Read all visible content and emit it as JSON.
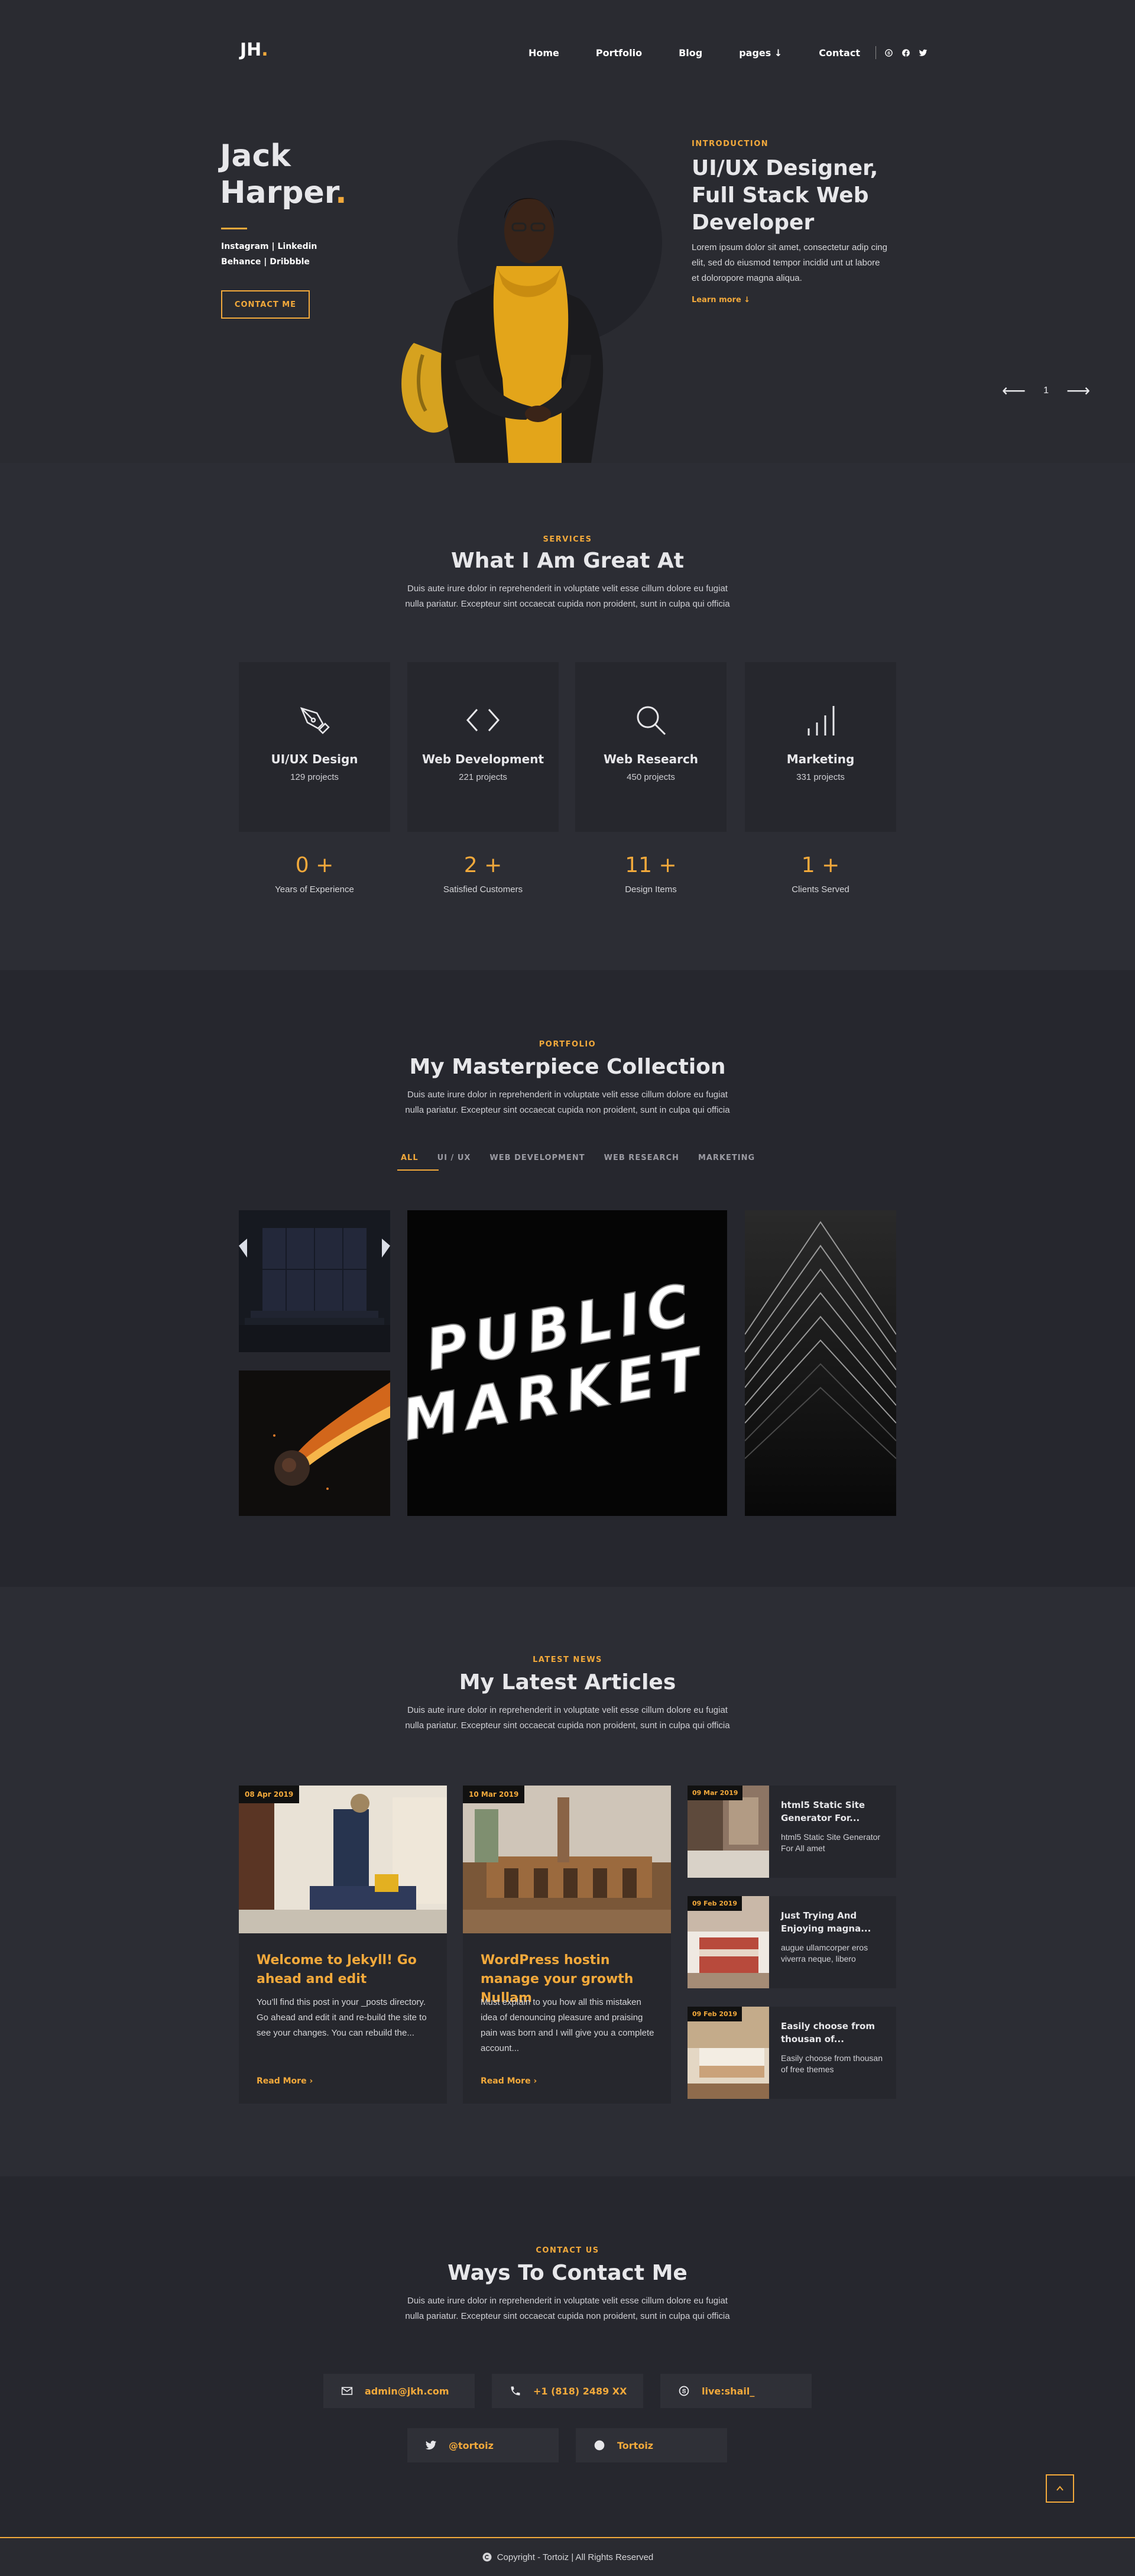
{
  "header": {
    "logo_text": "JH",
    "logo_dot": ".",
    "nav": [
      "Home",
      "Portfolio",
      "Blog",
      "pages",
      "Contact"
    ],
    "pages_caret": "↓",
    "social_icons": [
      "skype-icon",
      "facebook-icon",
      "twitter-icon"
    ]
  },
  "hero": {
    "first_name": "Jack",
    "last_name": "Harper",
    "dot": ".",
    "links_line1": "Instagram | Linkedin",
    "links_line2": "Behance | Dribbble",
    "contact_button": "CONTACT ME",
    "intro_kicker": "INTRODUCTION",
    "intro_title": "UI/UX Designer, Full Stack Web Developer",
    "intro_text": "Lorem ipsum dolor sit amet, consectetur adip cing elit, sed do eiusmod tempor incidid unt ut labore et doloropore magna aliqua.",
    "learn_more": "Learn more ↓",
    "slide_number": "1",
    "prev_arrow": "⟵",
    "next_arrow": "⟶"
  },
  "services": {
    "kicker": "SERVICES",
    "title": "What I Am Great At",
    "desc": "Duis aute irure dolor in reprehenderit in voluptate velit esse cillum dolore eu fugiat nulla pariatur. Excepteur sint occaecat cupida non proident, sunt in culpa qui officia",
    "cards": [
      {
        "name": "UI/UX Design",
        "count": "129 projects",
        "icon": "pen-tool-icon"
      },
      {
        "name": "Web Development",
        "count": "221 projects",
        "icon": "code-icon"
      },
      {
        "name": "Web Research",
        "count": "450 projects",
        "icon": "magnifier-icon"
      },
      {
        "name": "Marketing",
        "count": "331 projects",
        "icon": "bar-chart-icon"
      }
    ],
    "stats": [
      {
        "value": "0 +",
        "label": "Years of Experience"
      },
      {
        "value": "2 +",
        "label": "Satisfied Customers"
      },
      {
        "value": "11 +",
        "label": "Design Items"
      },
      {
        "value": "1 +",
        "label": "Clients Served"
      }
    ]
  },
  "portfolio": {
    "kicker": "PORTFOLIO",
    "title": "My Masterpiece Collection",
    "desc": "Duis aute irure dolor in reprehenderit in voluptate velit esse cillum dolore eu fugiat nulla pariatur. Excepteur sint occaecat cupida non proident, sunt in culpa qui officia",
    "filters": [
      "ALL",
      "UI / UX",
      "WEB DEVELOPMENT",
      "WEB RESEARCH",
      "MARKETING"
    ],
    "sign_line1": "PUBLIC",
    "sign_line2": "MARKET"
  },
  "news": {
    "kicker": "LATEST NEWS",
    "title": "My Latest Articles",
    "desc": "Duis aute irure dolor in reprehenderit in voluptate velit esse cillum dolore eu fugiat nulla pariatur. Excepteur sint occaecat cupida non proident, sunt in culpa qui officia",
    "posts": [
      {
        "date": "08 Apr 2019",
        "title": "Welcome to Jekyll! Go ahead and edit",
        "text": "You’ll find this post in your _posts directory. Go ahead and edit it and re-build the site to see your changes. You can rebuild the...",
        "read_more": "Read More"
      },
      {
        "date": "10 Mar 2019",
        "title": "WordPress hostin manage your growth Nullam",
        "text": "Must explain to you how all this mistaken idea of denouncing pleasure and praising pain was born and I will give you a complete account...",
        "read_more": "Read More"
      }
    ],
    "mini_posts": [
      {
        "date": "09 Mar 2019",
        "title": "html5 Static Site Generator For...",
        "text": "html5 Static Site Generator For All amet"
      },
      {
        "date": "09 Feb 2019",
        "title": "Just Trying And Enjoying magna...",
        "text": "augue ullamcorper eros viverra neque, libero"
      },
      {
        "date": "09 Feb 2019",
        "title": "Easily choose from thousan of...",
        "text": "Easily choose from thousan of free themes"
      }
    ]
  },
  "contact": {
    "kicker": "CONTACT US",
    "title": "Ways To Contact Me",
    "desc": "Duis aute irure dolor in reprehenderit in voluptate velit esse cillum dolore eu fugiat nulla pariatur. Excepteur sint occaecat cupida non proident, sunt in culpa qui officia",
    "email": "admin@jkh.com",
    "phone": "+1 (818) 2489 XX",
    "skype": "live:shail_",
    "twitter": "@tortoiz",
    "dribbble": "Tortoiz"
  },
  "footer": {
    "copyright": "Copyright - Tortoiz | All Rights Reserved"
  },
  "colors": {
    "accent": "#f2a93b",
    "background": "#26272e",
    "card": "#26272d"
  }
}
